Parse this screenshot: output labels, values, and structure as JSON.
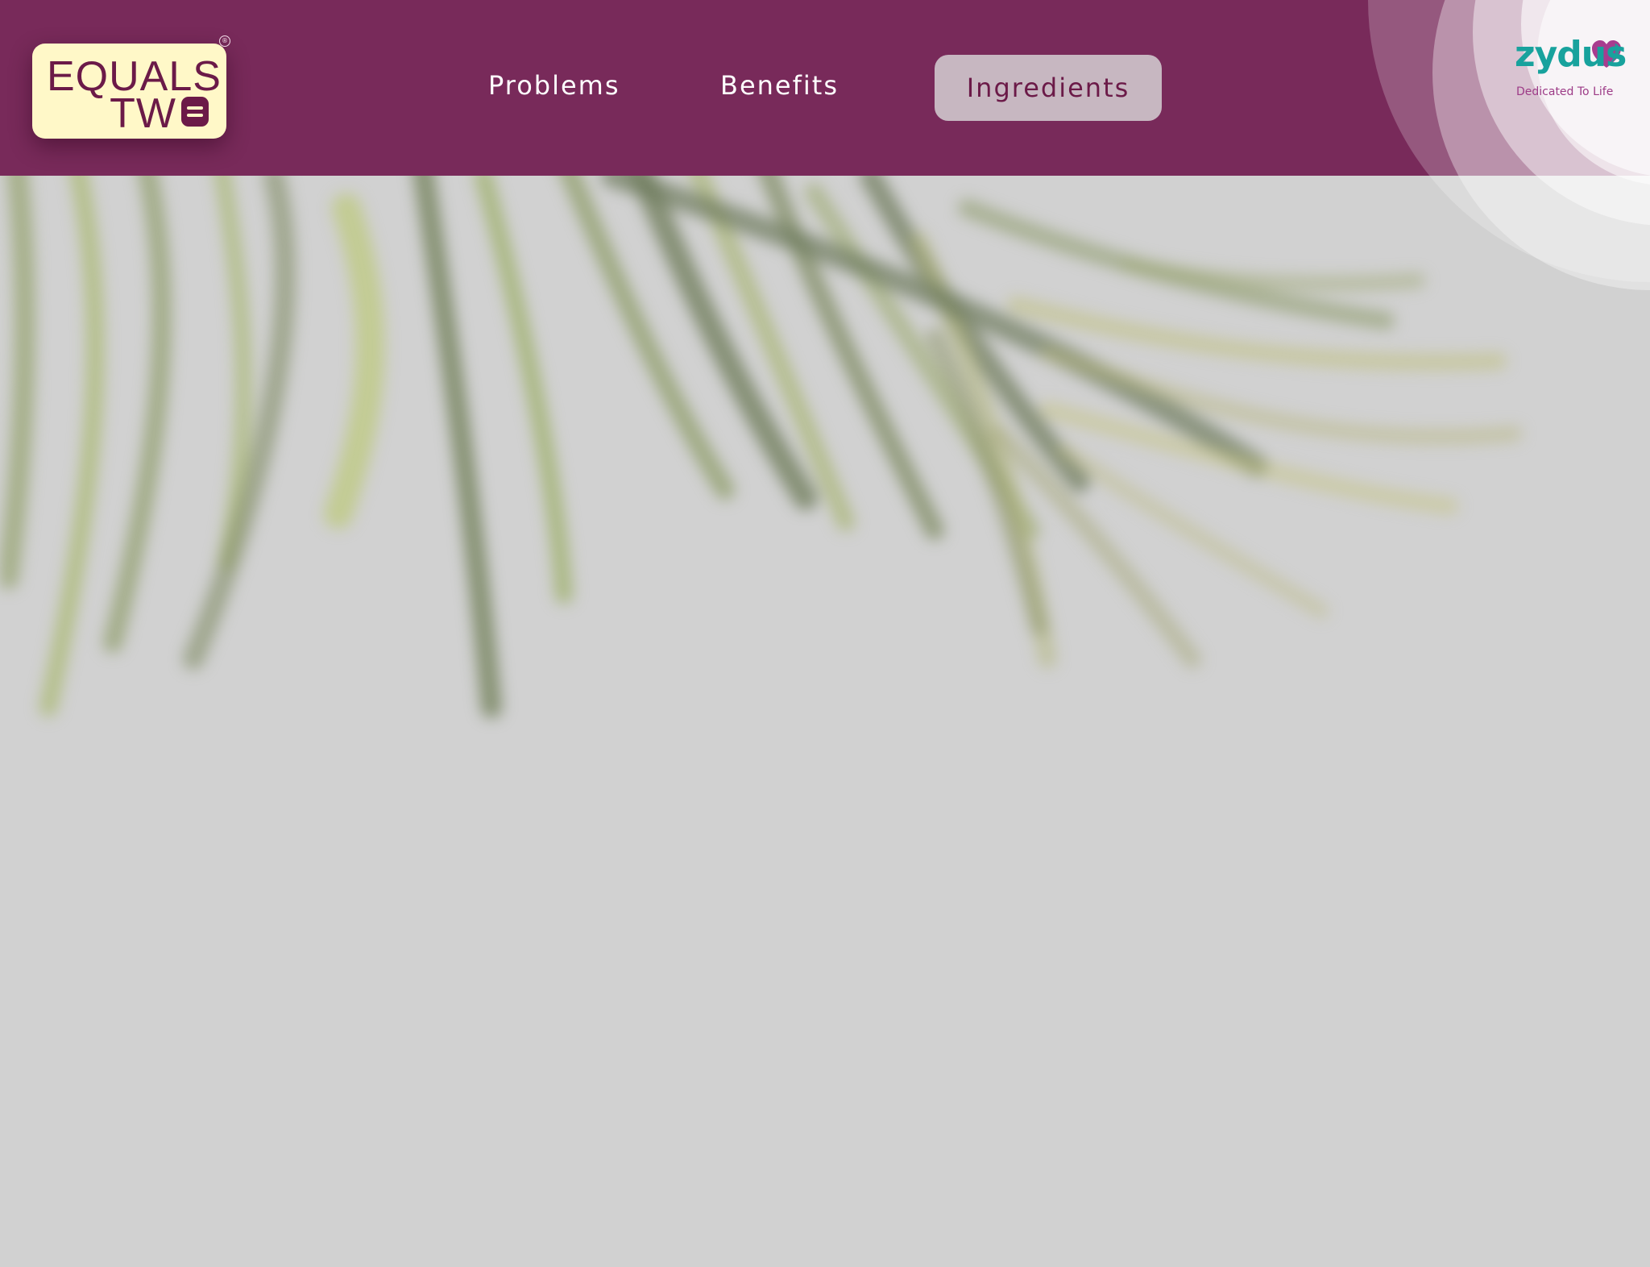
{
  "brand": {
    "logo_line1": "EQUALS",
    "logo_line2": "TW",
    "registered_mark": "®",
    "logo_colors": {
      "background": "#fff8c8",
      "text": "#6b1a48"
    }
  },
  "nav": {
    "items": [
      {
        "label": "Problems",
        "active": false
      },
      {
        "label": "Benefits",
        "active": false
      },
      {
        "label": "Ingredients",
        "active": true
      }
    ]
  },
  "partner": {
    "name": "zydus",
    "tagline": "Dedicated To Life",
    "colors": {
      "wordmark": "#18a29d",
      "heart_primary": "#a83c8f",
      "tagline": "#9d3b87"
    }
  },
  "theme": {
    "header_bg": "#782a5a",
    "page_bg": "#d1d1d1",
    "active_nav_bg": "#c7b7c1",
    "active_nav_text": "#6b1a48"
  },
  "icons": {
    "equals_mark": "equals-sign-icon",
    "partner_heart": "heart-icon",
    "background": "palm-fronds-image"
  }
}
